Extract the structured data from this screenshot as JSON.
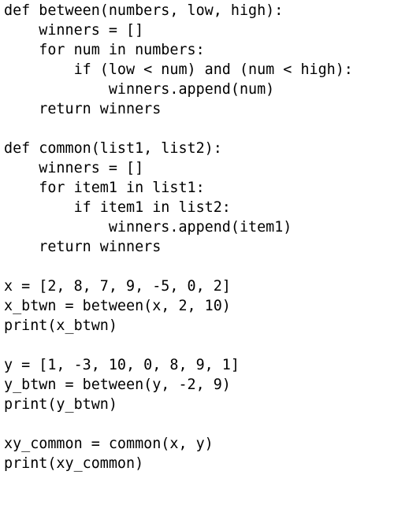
{
  "editor": {
    "lines": [
      "def between(numbers, low, high):",
      "    winners = []",
      "    for num in numbers:",
      "        if (low < num) and (num < high):",
      "            winners.append(num)",
      "    return winners",
      "",
      "def common(list1, list2):",
      "    winners = []",
      "    for item1 in list1:",
      "        if item1 in list2:",
      "            winners.append(item1)",
      "    return winners",
      "",
      "x = [2, 8, 7, 9, -5, 0, 2]",
      "x_btwn = between(x, 2, 10)",
      "print(x_btwn)",
      "",
      "y = [1, -3, 10, 0, 8, 9, 1]",
      "y_btwn = between(y, -2, 9)",
      "print(y_btwn)",
      "",
      "xy_common = common(x, y)",
      "print(xy_common)"
    ]
  }
}
